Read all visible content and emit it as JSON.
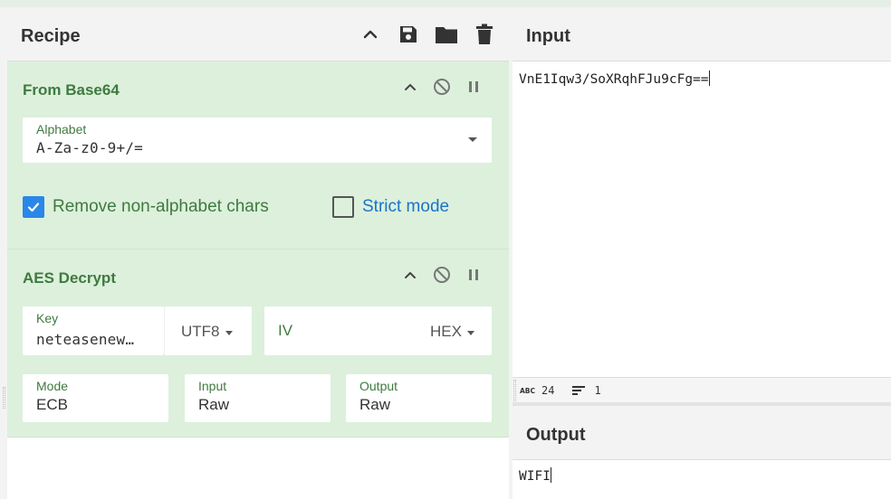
{
  "recipe": {
    "title": "Recipe",
    "header_icons": [
      "chevron-up-icon",
      "save-icon",
      "folder-icon",
      "trash-icon"
    ]
  },
  "operations": {
    "from_base64": {
      "title": "From Base64",
      "alphabet_label": "Alphabet",
      "alphabet_value": "A-Za-z0-9+/=",
      "remove_nonalpha_label": "Remove non-alphabet chars",
      "remove_nonalpha_checked": true,
      "strict_mode_label": "Strict mode",
      "strict_mode_checked": false
    },
    "aes_decrypt": {
      "title": "AES Decrypt",
      "key_label": "Key",
      "key_value": "neteasenew…",
      "key_encoding": "UTF8",
      "iv_label": "IV",
      "iv_encoding": "HEX",
      "mode_label": "Mode",
      "mode_value": "ECB",
      "input_label": "Input",
      "input_value": "Raw",
      "output_label": "Output",
      "output_value": "Raw"
    }
  },
  "input": {
    "title": "Input",
    "text": "VnE1Iqw3/SoXRqhFJu9cFg==",
    "status_length": "24",
    "status_lines": "1"
  },
  "output": {
    "title": "Output",
    "text": "WIFI"
  },
  "colors": {
    "op_bg": "#dcf0dc",
    "op_title": "#3f7a3f",
    "checkbox_accent": "#2a87e8",
    "strict_label": "#1a73c9"
  }
}
